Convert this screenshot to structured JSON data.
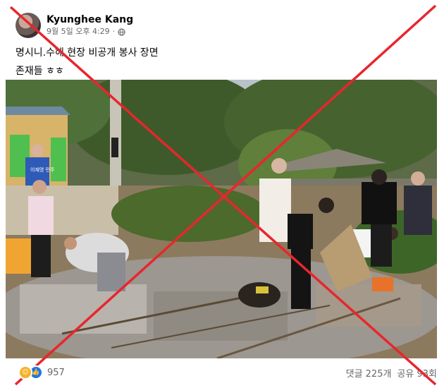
{
  "post": {
    "author": "Kyunghee Kang",
    "timestamp": "9월 5일 오후 4:29",
    "privacy_icon": "globe-icon",
    "text_line1": "명시니.수해 현장 비공개 봉사 장면",
    "text_line2": "존재들 ㅎㅎ",
    "photo_sign_text": "이재명 민주"
  },
  "footer": {
    "reaction_icons": [
      "haha-icon",
      "like-icon"
    ],
    "reaction_count": "957",
    "comments": "댓글 225개",
    "shares": "공유 93회"
  },
  "colors": {
    "cross_mark": "#e8262d",
    "author_text": "#050505",
    "meta_text": "#65676b",
    "like_blue": "#1877f2"
  }
}
